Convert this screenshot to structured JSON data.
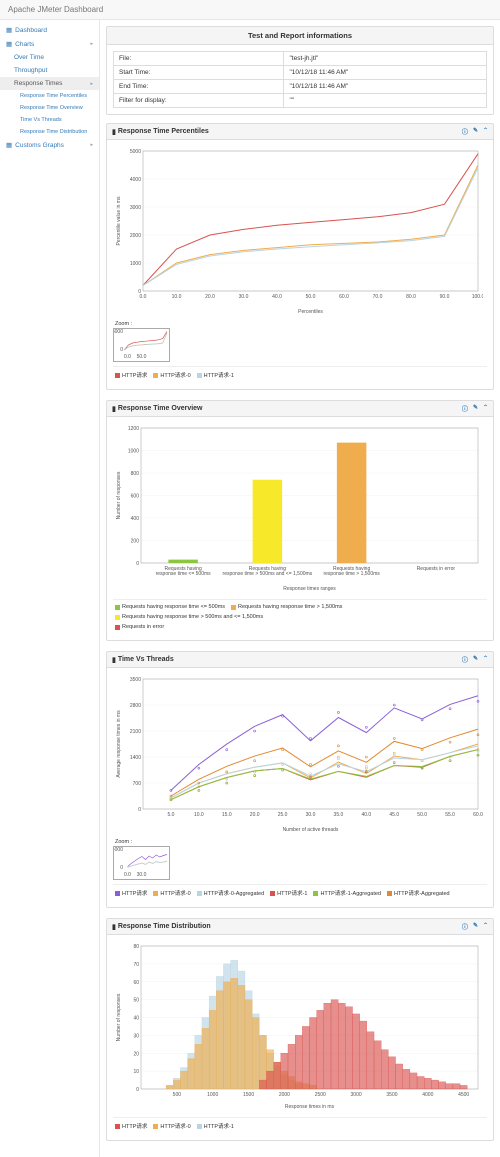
{
  "app_title": "Apache JMeter Dashboard",
  "sidebar": {
    "items": [
      {
        "icon": "home-icon",
        "label": "Dashboard"
      },
      {
        "icon": "bar-chart-icon",
        "label": "Charts",
        "caret": true
      },
      {
        "label": "Over Time",
        "sub": true
      },
      {
        "label": "Throughput",
        "sub": true
      },
      {
        "label": "Response Times",
        "sub": true,
        "active": true,
        "caret": true
      },
      {
        "label": "Response Time Percentiles",
        "subsub": true
      },
      {
        "label": "Response Time Overview",
        "subsub": true
      },
      {
        "label": "Time Vs Threads",
        "subsub": true
      },
      {
        "label": "Response Time Distribution",
        "subsub": true
      },
      {
        "icon": "area-chart-icon",
        "label": "Customs Graphs",
        "caret": true
      }
    ]
  },
  "info": {
    "title": "Test and Report informations",
    "rows": [
      {
        "k": "File:",
        "v": "\"test-jh.jtl\""
      },
      {
        "k": "Start Time:",
        "v": "\"10/12/18 11:46 AM\""
      },
      {
        "k": "End Time:",
        "v": "\"10/12/18 11:46 AM\""
      },
      {
        "k": "Filter for display:",
        "v": "\"\""
      }
    ]
  },
  "panels": {
    "percentiles": {
      "title": "Response Time Percentiles",
      "zoom": "Zoom :"
    },
    "overview": {
      "title": "Response Time Overview"
    },
    "threads": {
      "title": "Time Vs Threads",
      "zoom": "Zoom :"
    },
    "distribution": {
      "title": "Response Time Distribution"
    }
  },
  "series_labels": {
    "http": "HTTP请求",
    "http0": "HTTP请求-0",
    "http1": "HTTP请求-1",
    "http0agg": "HTTP请求-0-Aggregated",
    "http1agg": "HTTP请求-1-Aggregated",
    "httpagg": "HTTP请求-Aggregated"
  },
  "overview_legend": {
    "a": "Requests having response time <= 500ms",
    "b": "Requests having response time > 1,500ms",
    "c": "Requests having response time > 500ms and <= 1,500ms",
    "d": "Requests in error"
  },
  "colors": {
    "red": "#d9534f",
    "orange": "#f0ad4e",
    "lblue": "#b9d4e2",
    "green": "#8cc63f",
    "yellow": "#f7e92a",
    "purple": "#8a5fd6",
    "darkorange": "#e08a2f"
  },
  "chart_data": [
    {
      "id": "percentiles",
      "type": "line",
      "title": "Response Time Percentiles",
      "xlabel": "Percentiles",
      "ylabel": "Percentile value in ms",
      "x": [
        0,
        10,
        20,
        30,
        40,
        50,
        60,
        70,
        80,
        90,
        100
      ],
      "xlim": [
        0,
        100
      ],
      "ylim": [
        0,
        5000
      ],
      "series": [
        {
          "name": "HTTP请求",
          "color": "#d9534f",
          "values": [
            200,
            1500,
            2000,
            2200,
            2350,
            2450,
            2550,
            2650,
            2800,
            3100,
            4900
          ]
        },
        {
          "name": "HTTP请求-0",
          "color": "#f0ad4e",
          "values": [
            200,
            1000,
            1300,
            1450,
            1550,
            1650,
            1700,
            1750,
            1850,
            2000,
            4500
          ]
        },
        {
          "name": "HTTP请求-1",
          "color": "#b9d4e2",
          "values": [
            200,
            950,
            1250,
            1400,
            1500,
            1580,
            1650,
            1720,
            1800,
            1950,
            4400
          ]
        }
      ]
    },
    {
      "id": "overview",
      "type": "bar",
      "title": "Response Time Overview",
      "xlabel": "Response times ranges",
      "ylabel": "Number of responses",
      "ylim": [
        0,
        1200
      ],
      "categories": [
        "Requests having\nresponse time <= 500ms",
        "Requests having\nresponse time > 500ms and <= 1,500ms",
        "Requests having\nresponse time > 1,500ms",
        "Requests in error"
      ],
      "colors": [
        "#8cc63f",
        "#f7e92a",
        "#f0ad4e",
        "#d9534f"
      ],
      "values": [
        30,
        740,
        1070,
        0
      ]
    },
    {
      "id": "threads",
      "type": "line",
      "title": "Time Vs Threads",
      "xlabel": "Number of active threads",
      "ylabel": "Average response times in ms",
      "xlim": [
        0,
        60
      ],
      "ylim": [
        0,
        3500
      ],
      "x": [
        5,
        10,
        15,
        20,
        25,
        30,
        35,
        40,
        45,
        50,
        55,
        60
      ],
      "series": [
        {
          "name": "HTTP请求",
          "color": "#8a5fd6",
          "values": [
            500,
            1100,
            1600,
            2100,
            2500,
            1900,
            2600,
            2200,
            2800,
            2400,
            2700,
            2900
          ]
        },
        {
          "name": "HTTP请求-0",
          "color": "#f0ad4e",
          "values": [
            300,
            600,
            800,
            1000,
            1200,
            900,
            1400,
            1100,
            1500,
            1300,
            1400,
            1600
          ]
        },
        {
          "name": "HTTP请求-0-Aggregated",
          "color": "#b9d4e2",
          "values": [
            300,
            600,
            800,
            1000,
            1200,
            950,
            1350,
            1150,
            1450,
            1300,
            1400,
            1550
          ]
        },
        {
          "name": "HTTP请求-1",
          "color": "#d9534f",
          "values": [
            250,
            500,
            700,
            900,
            1050,
            850,
            1150,
            1000,
            1250,
            1100,
            1300,
            1450
          ]
        },
        {
          "name": "HTTP请求-1-Aggregated",
          "color": "#8cc63f",
          "values": [
            250,
            500,
            700,
            900,
            1050,
            870,
            1150,
            1020,
            1250,
            1120,
            1300,
            1450
          ]
        },
        {
          "name": "HTTP请求-Aggregated",
          "color": "#e08a2f",
          "values": [
            350,
            700,
            1000,
            1300,
            1600,
            1200,
            1700,
            1400,
            1900,
            1600,
            1800,
            2000
          ]
        }
      ]
    },
    {
      "id": "distribution",
      "type": "bar",
      "title": "Response Time Distribution",
      "xlabel": "Response times in ms",
      "ylabel": "Number of responses",
      "xlim": [
        0,
        4700
      ],
      "ylim": [
        0,
        80
      ],
      "bin_width": 100,
      "series": [
        {
          "name": "HTTP请求",
          "color": "#d9534f",
          "x": [
            1700,
            1800,
            1900,
            2000,
            2100,
            2200,
            2300,
            2400,
            2500,
            2600,
            2700,
            2800,
            2900,
            3000,
            3100,
            3200,
            3300,
            3400,
            3500,
            3600,
            3700,
            3800,
            3900,
            4000,
            4100,
            4200,
            4300,
            4400,
            4500
          ],
          "values": [
            5,
            10,
            15,
            20,
            25,
            30,
            35,
            40,
            44,
            48,
            50,
            48,
            46,
            42,
            38,
            32,
            27,
            22,
            18,
            14,
            11,
            9,
            7,
            6,
            5,
            4,
            3,
            3,
            2
          ]
        },
        {
          "name": "HTTP请求-0",
          "color": "#f0ad4e",
          "x": [
            400,
            500,
            600,
            700,
            800,
            900,
            1000,
            1100,
            1200,
            1300,
            1400,
            1500,
            1600,
            1700,
            1800,
            1900,
            2000,
            2100,
            2200,
            2300,
            2400
          ],
          "values": [
            2,
            5,
            10,
            17,
            25,
            34,
            44,
            55,
            60,
            62,
            58,
            50,
            40,
            30,
            22,
            15,
            10,
            7,
            4,
            3,
            2
          ]
        },
        {
          "name": "HTTP请求-1",
          "color": "#b9d4e2",
          "x": [
            400,
            500,
            600,
            700,
            800,
            900,
            1000,
            1100,
            1200,
            1300,
            1400,
            1500,
            1600,
            1700,
            1800,
            1900,
            2000,
            2100,
            2200
          ],
          "values": [
            2,
            6,
            12,
            20,
            30,
            40,
            52,
            63,
            70,
            72,
            66,
            55,
            42,
            30,
            20,
            13,
            8,
            5,
            3
          ]
        }
      ]
    }
  ]
}
